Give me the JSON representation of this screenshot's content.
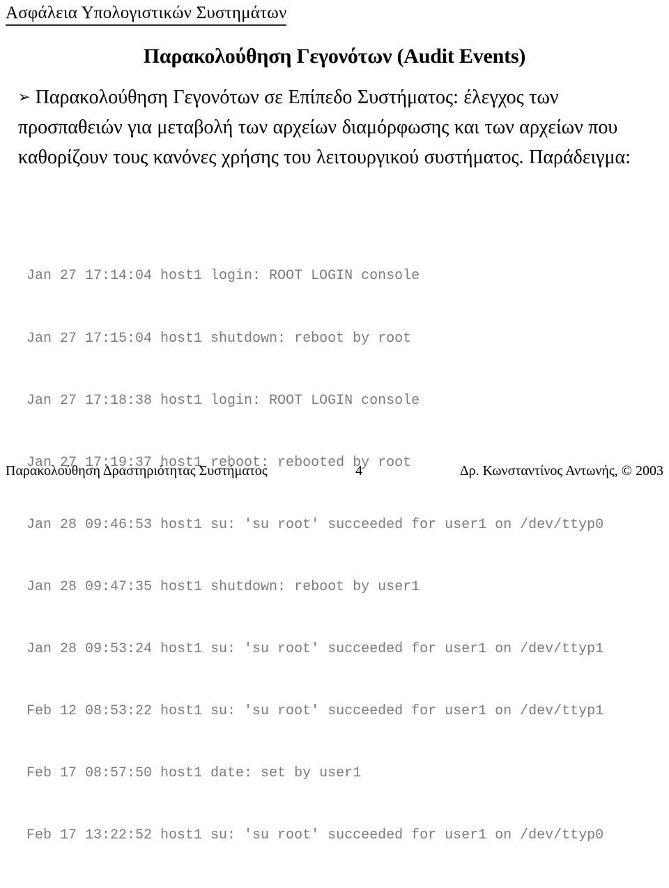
{
  "header": {
    "text": "Ασφάλεια Υπολογιστικών Συστημάτων"
  },
  "title": {
    "text": "Παρακολούθηση Γεγονότων (Audit Events)"
  },
  "body": {
    "bullet_marker": "➢",
    "bullet_text": "Παρακολούθηση Γεγονότων σε Επίπεδο Συστήματος: έλεγχος των προσπαθειών για μεταβολή των αρχείων διαμόρφωσης και των αρχείων που καθορίζουν τους κανόνες χρήσης του λειτουργικού συστήματος. Παράδειγμα:"
  },
  "log": {
    "lines": [
      "Jan 27 17:14:04 host1 login: ROOT LOGIN console",
      "Jan 27 17:15:04 host1 shutdown: reboot by root",
      "Jan 27 17:18:38 host1 login: ROOT LOGIN console",
      "Jan 27 17:19:37 host1 reboot: rebooted by root",
      "Jan 28 09:46:53 host1 su: 'su root' succeeded for user1 on /dev/ttyp0",
      "Jan 28 09:47:35 host1 shutdown: reboot by user1",
      "Jan 28 09:53:24 host1 su: 'su root' succeeded for user1 on /dev/ttyp1",
      "Feb 12 08:53:22 host1 su: 'su root' succeeded for user1 on /dev/ttyp1",
      "Feb 17 08:57:50 host1 date: set by user1",
      "Feb 17 13:22:52 host1 su: 'su root' succeeded for user1 on /dev/ttyp0"
    ],
    "color": "#7c7c7c"
  },
  "footer": {
    "left": "Παρακολούθηση Δραστηριότητας Συστήματος",
    "page_number": "4",
    "right": "Δρ. Κωνσταντίνος Αντωνής, © 2003"
  }
}
